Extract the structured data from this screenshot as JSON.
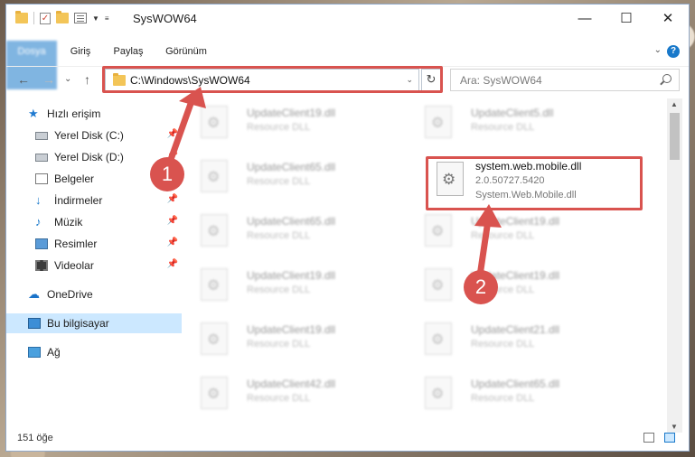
{
  "window": {
    "title": "SysWOW64",
    "minimize": "—",
    "maximize": "☐",
    "close": "✕"
  },
  "ribbon": {
    "tabs": [
      "Dosya",
      "Giriş",
      "Paylaş",
      "Görünüm"
    ],
    "help": "?"
  },
  "nav": {
    "back": "←",
    "forward": "→",
    "recent": "⌄",
    "up": "↑",
    "address": "C:\\Windows\\SysWOW64",
    "refresh": "↻",
    "search_placeholder": "Ara: SysWOW64"
  },
  "sidebar": {
    "items": [
      {
        "label": "Hızlı erişim",
        "icon": "star-icon"
      },
      {
        "label": "Yerel Disk (C:)",
        "icon": "disk-icon",
        "pinned": true
      },
      {
        "label": "Yerel Disk (D:)",
        "icon": "disk-icon",
        "pinned": true
      },
      {
        "label": "Belgeler",
        "icon": "document-icon",
        "pinned": true
      },
      {
        "label": "İndirmeler",
        "icon": "download-icon",
        "pinned": true
      },
      {
        "label": "Müzik",
        "icon": "music-icon",
        "pinned": true
      },
      {
        "label": "Resimler",
        "icon": "pictures-icon",
        "pinned": true
      },
      {
        "label": "Videolar",
        "icon": "video-icon",
        "pinned": true
      },
      {
        "label": "OneDrive",
        "icon": "cloud-icon"
      },
      {
        "label": "Bu bilgisayar",
        "icon": "computer-icon",
        "selected": true
      },
      {
        "label": "Ağ",
        "icon": "network-icon"
      }
    ]
  },
  "files": {
    "blurred": [
      {
        "name": "UpdateClient19.dll",
        "type": "Resource DLL"
      },
      {
        "name": "UpdateClient5.dll",
        "type": "Resource DLL"
      },
      {
        "name": "UpdateClient65.dll",
        "type": "Resource DLL"
      },
      {
        "name": "UpdateClient65.dll",
        "type": "Resource DLL"
      },
      {
        "name": "UpdateClient19.dll",
        "type": "Resource DLL"
      },
      {
        "name": "UpdateClient19.dll",
        "type": "Resource DLL"
      },
      {
        "name": "UpdateClient19.dll",
        "type": "Resource DLL"
      },
      {
        "name": "UpdateClient19.dll",
        "type": "Resource DLL"
      },
      {
        "name": "UpdateClient21.dll",
        "type": "Resource DLL"
      },
      {
        "name": "UpdateClient42.dll",
        "type": "Resource DLL"
      },
      {
        "name": "UpdateClient65.dll",
        "type": "Resource DLL"
      }
    ],
    "target": {
      "name": "system.web.mobile.dll",
      "version": "2.0.50727.5420",
      "description": "System.Web.Mobile.dll"
    }
  },
  "annotations": {
    "step1": "1",
    "step2": "2",
    "color": "#d9534f"
  },
  "status": {
    "count": "151 öğe"
  }
}
